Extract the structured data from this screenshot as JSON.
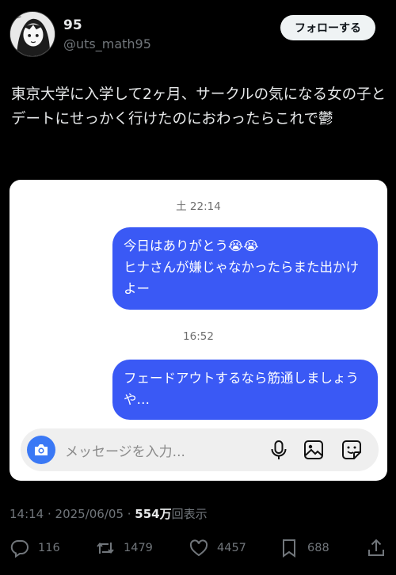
{
  "author": {
    "display_name": "95",
    "handle": "@uts_math95",
    "follow_label": "フォローする"
  },
  "post": {
    "text": "東京大学に入学して2ヶ月、サークルの気になる女の子とデートにせっかく行けたのにおわったらこれで鬱"
  },
  "screenshot": {
    "timestamp_1": "土 22:14",
    "message_1_line1": "今日はありがとう😭😭",
    "message_1_line2": "ヒナさんが嫌じゃなかったらまた出かけよー",
    "timestamp_2": "16:52",
    "message_2": "フェードアウトするなら筋通しましょうや…",
    "composer_placeholder": "メッセージを入力..."
  },
  "meta": {
    "time_date": "14:14 · 2025/06/05 · ",
    "views_number": "554万",
    "views_label": "回表示"
  },
  "stats": {
    "replies": "116",
    "reposts": "1479",
    "likes": "4457",
    "bookmarks": "688"
  },
  "icons": [
    "avatar",
    "camera-icon",
    "mic-icon",
    "gallery-icon",
    "sticker-icon",
    "reply-icon",
    "repost-icon",
    "like-icon",
    "bookmark-icon",
    "share-icon"
  ],
  "colors": {
    "background": "#000000",
    "bubble": "#3a59f5",
    "camera": "#3a78f5",
    "muted": "#71767b"
  }
}
